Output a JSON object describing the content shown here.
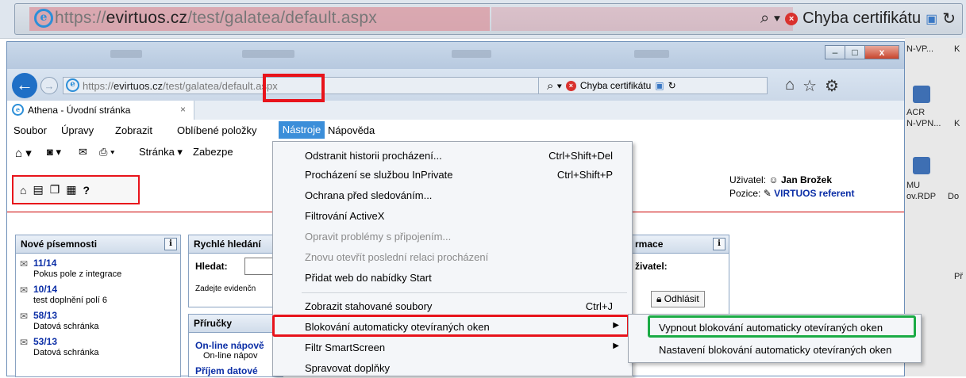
{
  "outer_browser": {
    "url_prefix": "https://",
    "url_domain": "evirtuos.cz",
    "url_path": "/test/galatea/default.aspx",
    "search_icon": "search-icon",
    "cert_error": "Chyba certifikátu"
  },
  "desktop": {
    "labels": [
      "N-VP...",
      "K",
      "ACR",
      "N-VPN...",
      "K",
      "MU",
      "ov.RDP",
      "Do",
      "Př"
    ]
  },
  "window": {
    "url_prefix": "https://",
    "url_domain": "evirtuos.cz",
    "url_path": "/test/galatea/default.aspx",
    "cert_error": "Chyba certifikátu",
    "tab_title": "Athena - Úvodní stránka",
    "tab_close": "×",
    "buttons": {
      "minimize": "–",
      "maximize": "□",
      "close": "x"
    }
  },
  "menubar": {
    "items": [
      "Soubor",
      "Úpravy",
      "Zobrazit",
      "Oblíbené položky",
      "Nástroje",
      "Nápověda"
    ],
    "active": "Nástroje"
  },
  "commandbar": {
    "page": "Stránka ▾",
    "safety": "Zabezpe"
  },
  "toolbar_icons": [
    "home-icon",
    "new-doc-icon",
    "copy-icon",
    "doc-icon",
    "help-icon"
  ],
  "help_glyph": "?",
  "user": {
    "user_label": "Uživatel:",
    "user_name": "Jan Brožek",
    "position_label": "Pozice:",
    "position_value": "VIRTUOS referent"
  },
  "panels": {
    "new_docs": {
      "title": "Nové písemnosti",
      "info": "i",
      "items": [
        {
          "num": "11/14",
          "desc": "Pokus pole z integrace"
        },
        {
          "num": "10/14",
          "desc": "test doplnění polí 6"
        },
        {
          "num": "58/13",
          "desc": "Datová schránka"
        },
        {
          "num": "53/13",
          "desc": "Datová schránka"
        }
      ]
    },
    "quick_search": {
      "title": "Rychlé hledání",
      "search_label": "Hledat:",
      "hint": "Zadejte evidenčn"
    },
    "manuals": {
      "title": "Příručky",
      "link1": "On-line nápově",
      "link1_sub": "On-line nápov",
      "link2": "Příjem datové"
    },
    "info": {
      "title": "rmace",
      "info": "i",
      "user_label": "živatel:",
      "logout": "Odhlásit"
    }
  },
  "tools_menu": {
    "items": [
      {
        "label": "Odstranit historii procházení...",
        "shortcut": "Ctrl+Shift+Del",
        "disabled": false
      },
      {
        "label": "Procházení se službou InPrivate",
        "shortcut": "Ctrl+Shift+P",
        "disabled": false
      },
      {
        "label": "Ochrana před sledováním...",
        "shortcut": "",
        "disabled": false
      },
      {
        "label": "Filtrování ActiveX",
        "shortcut": "",
        "disabled": false
      },
      {
        "label": "Opravit problémy s připojením...",
        "shortcut": "",
        "disabled": true
      },
      {
        "label": "Znovu otevřít poslední relaci procházení",
        "shortcut": "",
        "disabled": true
      },
      {
        "label": "Přidat web do nabídky Start",
        "shortcut": "",
        "disabled": false
      },
      {
        "label": "Zobrazit stahované soubory",
        "shortcut": "Ctrl+J",
        "disabled": false
      },
      {
        "label": "Blokování automaticky otevíraných oken",
        "shortcut": "",
        "disabled": false,
        "submenu": true
      },
      {
        "label": "Filtr SmartScreen",
        "shortcut": "",
        "disabled": false,
        "submenu": true
      },
      {
        "label": "Spravovat doplňky",
        "shortcut": "",
        "disabled": false
      }
    ]
  },
  "popup_submenu": {
    "items": [
      "Vypnout blokování automaticky otevíraných oken",
      "Nastavení blokování automaticky otevíraných oken"
    ]
  },
  "colors": {
    "highlight_red": "#e8131b",
    "highlight_green": "#1bab45",
    "menu_active": "#3b8ed9",
    "link_blue": "#0b2ea6"
  }
}
